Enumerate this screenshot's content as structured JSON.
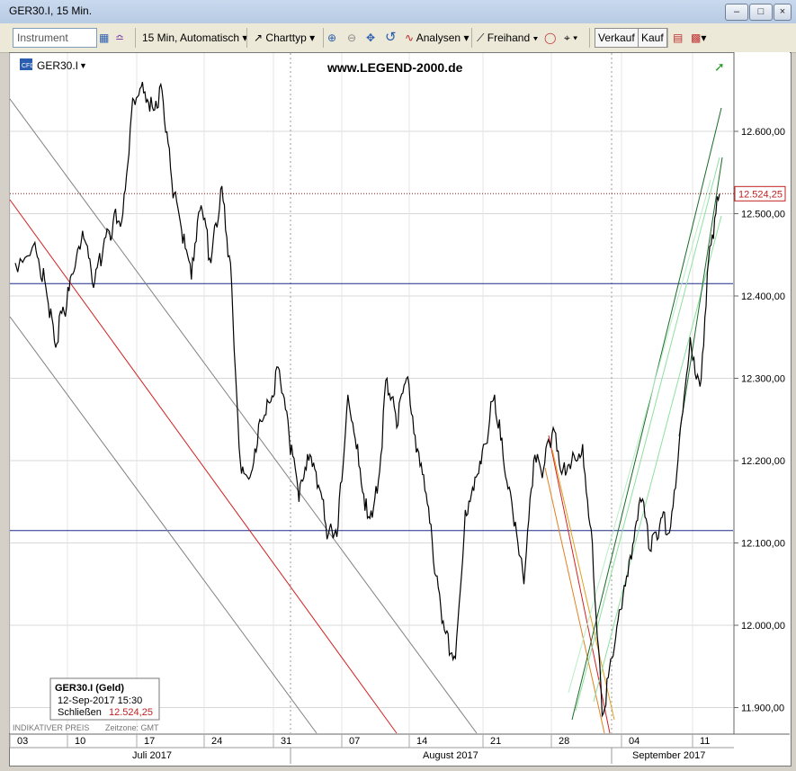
{
  "window": {
    "title": "GER30.I, 15 Min."
  },
  "toolbar": {
    "instrument_placeholder": "Instrument",
    "interval": "15 Min, Automatisch",
    "charttype": "Charttyp",
    "analysen": "Analysen",
    "freihand": "Freihand",
    "verkauf": "Verkauf",
    "kauf": "Kauf"
  },
  "chart": {
    "instrument": "GER30.I",
    "watermark": "www.LEGEND-2000.de",
    "current_price": "12.524,25",
    "indikativ": "INDIKATIVER PREIS",
    "zeitzone": "Zeitzone: GMT"
  },
  "info_box": {
    "title": "GER30.I (Geld)",
    "datetime": "12-Sep-2017 15:30",
    "close_label": "Schließen",
    "close_value": "12.524,25"
  },
  "chart_data": {
    "type": "line",
    "title": "GER30.I, 15 Min.",
    "xlabel": "",
    "ylabel": "",
    "ylim": [
      11870,
      12700
    ],
    "x_tick_labels": [
      "03",
      "10",
      "17",
      "24",
      "31",
      "07",
      "14",
      "21",
      "28",
      "04",
      "11"
    ],
    "month_labels": [
      "Juli 2017",
      "August 2017",
      "September 2017"
    ],
    "y_ticks": [
      {
        "value": 12600,
        "label": "12.600,00"
      },
      {
        "value": 12500,
        "label": "12.500,00"
      },
      {
        "value": 12400,
        "label": "12.400,00"
      },
      {
        "value": 12300,
        "label": "12.300,00"
      },
      {
        "value": 12200,
        "label": "12.200,00"
      },
      {
        "value": 12100,
        "label": "12.100,00"
      },
      {
        "value": 12000,
        "label": "12.000,00"
      },
      {
        "value": 11900,
        "label": "11.900,00"
      }
    ],
    "horizontal_lines": [
      12415,
      12115
    ],
    "current_price": 12524.25,
    "series": [
      {
        "x": [
          0,
          2,
          3,
          4,
          5,
          6,
          7,
          8,
          9,
          10,
          11,
          12,
          13,
          14,
          15,
          16,
          17,
          18,
          19,
          20,
          21,
          22,
          23,
          24,
          25,
          26,
          27,
          28,
          29,
          30,
          31,
          32,
          33,
          34,
          35,
          36,
          37,
          38,
          39,
          40,
          41,
          42,
          43,
          44,
          45,
          46,
          47,
          48,
          49,
          50,
          51,
          52,
          53,
          54,
          55,
          56,
          57,
          58,
          59,
          60,
          61,
          62,
          63,
          64,
          65,
          66,
          67,
          68,
          69,
          70,
          71,
          72
        ],
        "values": [
          12440,
          12465,
          12420,
          12345,
          12380,
          12430,
          12470,
          12410,
          12460,
          12490,
          12500,
          12640,
          12660,
          12630,
          12650,
          12540,
          12480,
          12420,
          12510,
          12440,
          12530,
          12440,
          12200,
          12180,
          12250,
          12270,
          12310,
          12230,
          12150,
          12200,
          12170,
          12110,
          12120,
          12280,
          12220,
          12130,
          12160,
          12300,
          12240,
          12300,
          12210,
          12160,
          12060,
          11990,
          11960,
          12140,
          12180,
          12220,
          12280,
          12190,
          12120,
          12050,
          12200,
          12190,
          12240,
          12190,
          12210,
          12220,
          12100,
          11890,
          11960,
          12020,
          12080,
          12150,
          12090,
          12130,
          12120,
          12240,
          12350,
          12290,
          12460,
          12524
        ]
      }
    ]
  }
}
